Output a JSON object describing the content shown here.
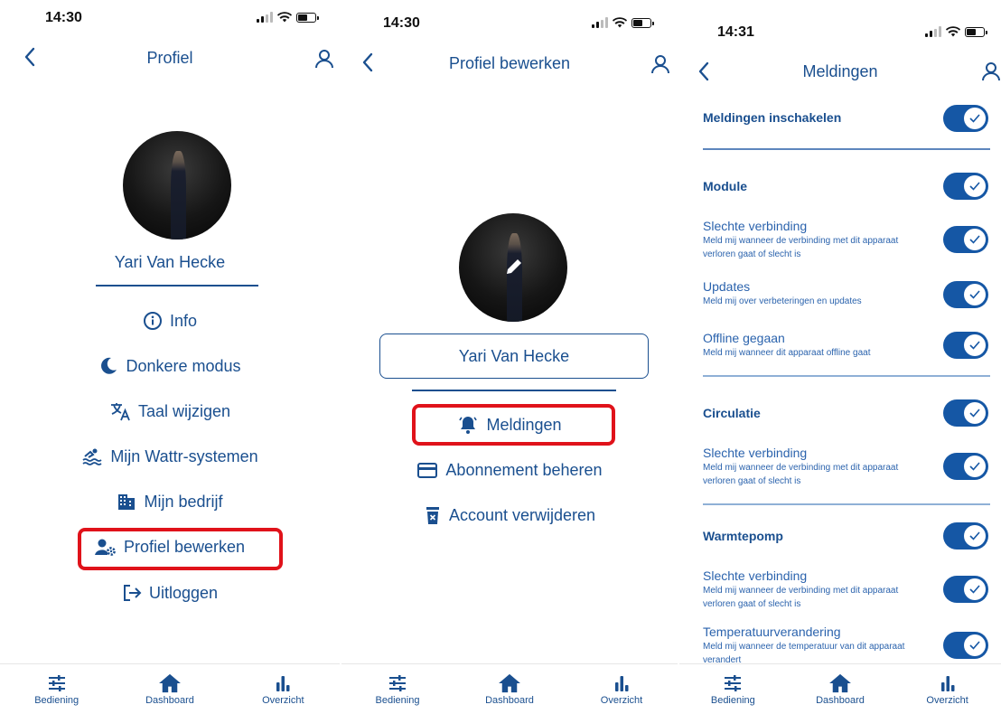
{
  "colors": {
    "primary": "#1a4f8f",
    "toggle_on": "#1557a5",
    "highlight": "#e0121a"
  },
  "screen1": {
    "time": "14:30",
    "title": "Profiel",
    "user_name": "Yari Van Hecke",
    "menu": [
      {
        "label": "Info",
        "icon": "info-icon"
      },
      {
        "label": "Donkere modus",
        "icon": "moon-icon"
      },
      {
        "label": "Taal wijzigen",
        "icon": "translate-icon"
      },
      {
        "label": "Mijn Wattr-systemen",
        "icon": "pool-icon"
      },
      {
        "label": "Mijn bedrijf",
        "icon": "building-icon"
      },
      {
        "label": "Profiel bewerken",
        "icon": "user-cog-icon",
        "highlighted": true
      },
      {
        "label": "Uitloggen",
        "icon": "logout-icon"
      }
    ]
  },
  "screen2": {
    "time": "14:30",
    "title": "Profiel bewerken",
    "name_value": "Yari Van Hecke",
    "menu": [
      {
        "label": "Meldingen",
        "icon": "bell-icon",
        "highlighted": true
      },
      {
        "label": "Abonnement beheren",
        "icon": "credit-card-icon"
      },
      {
        "label": "Account verwijderen",
        "icon": "trash-icon"
      }
    ]
  },
  "screen3": {
    "time": "14:31",
    "title": "Meldingen",
    "master": {
      "label": "Meldingen inschakelen",
      "enabled": true
    },
    "sections": [
      {
        "label": "Module",
        "enabled": true,
        "items": [
          {
            "title": "Slechte verbinding",
            "desc": "Meld mij wanneer de verbinding met dit apparaat verloren gaat of slecht is",
            "enabled": true
          },
          {
            "title": "Updates",
            "desc": "Meld mij over verbeteringen en updates",
            "enabled": true
          },
          {
            "title": "Offline gegaan",
            "desc": "Meld mij wanneer dit apparaat offline gaat",
            "enabled": true
          }
        ]
      },
      {
        "label": "Circulatie",
        "enabled": true,
        "items": [
          {
            "title": "Slechte verbinding",
            "desc": "Meld mij wanneer de verbinding met dit apparaat verloren gaat of slecht is",
            "enabled": true
          }
        ]
      },
      {
        "label": "Warmtepomp",
        "enabled": true,
        "items": [
          {
            "title": "Slechte verbinding",
            "desc": "Meld mij wanneer de verbinding met dit apparaat verloren gaat of slecht is",
            "enabled": true
          },
          {
            "title": "Temperatuurverandering",
            "desc": "Meld mij wanneer de temperatuur van dit apparaat verandert",
            "enabled": true
          }
        ]
      }
    ]
  },
  "tabbar": [
    {
      "label": "Bediening",
      "icon": "sliders-icon"
    },
    {
      "label": "Dashboard",
      "icon": "home-icon"
    },
    {
      "label": "Overzicht",
      "icon": "bar-chart-icon"
    }
  ]
}
